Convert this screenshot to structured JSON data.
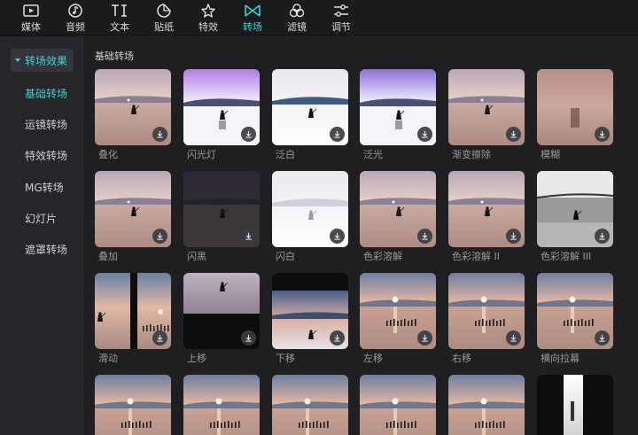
{
  "toolbar": {
    "items": [
      {
        "label": "媒体",
        "icon": "media-icon"
      },
      {
        "label": "音频",
        "icon": "audio-icon"
      },
      {
        "label": "文本",
        "icon": "text-icon"
      },
      {
        "label": "贴纸",
        "icon": "sticker-icon"
      },
      {
        "label": "特效",
        "icon": "effects-icon"
      },
      {
        "label": "转场",
        "icon": "transition-icon",
        "active": true
      },
      {
        "label": "滤镜",
        "icon": "filter-icon"
      },
      {
        "label": "调节",
        "icon": "adjust-icon"
      }
    ]
  },
  "sidebar": {
    "header": "转场效果",
    "items": [
      {
        "label": "基础转场",
        "active": true
      },
      {
        "label": "运镜转场"
      },
      {
        "label": "特效转场"
      },
      {
        "label": "MG转场"
      },
      {
        "label": "幻灯片"
      },
      {
        "label": "遮罩转场"
      }
    ]
  },
  "main": {
    "section_title": "基础转场",
    "cards": [
      {
        "name": "叠化"
      },
      {
        "name": "闪光灯"
      },
      {
        "name": "泛白"
      },
      {
        "name": "泛光"
      },
      {
        "name": "渐变擦除"
      },
      {
        "name": "模糊"
      },
      {
        "name": "叠加"
      },
      {
        "name": "闪黑"
      },
      {
        "name": "闪白"
      },
      {
        "name": "色彩溶解"
      },
      {
        "name": "色彩溶解 II"
      },
      {
        "name": "色彩溶解 III"
      },
      {
        "name": "滑动"
      },
      {
        "name": "上移"
      },
      {
        "name": "下移"
      },
      {
        "name": "左移"
      },
      {
        "name": "右移"
      },
      {
        "name": "横向拉幕"
      },
      {
        "name": ""
      },
      {
        "name": ""
      },
      {
        "name": ""
      },
      {
        "name": ""
      },
      {
        "name": ""
      },
      {
        "name": ""
      }
    ]
  },
  "colors": {
    "accent": "#3fd0d4",
    "background": "#1f1f22",
    "sidebar": "#26262a"
  }
}
